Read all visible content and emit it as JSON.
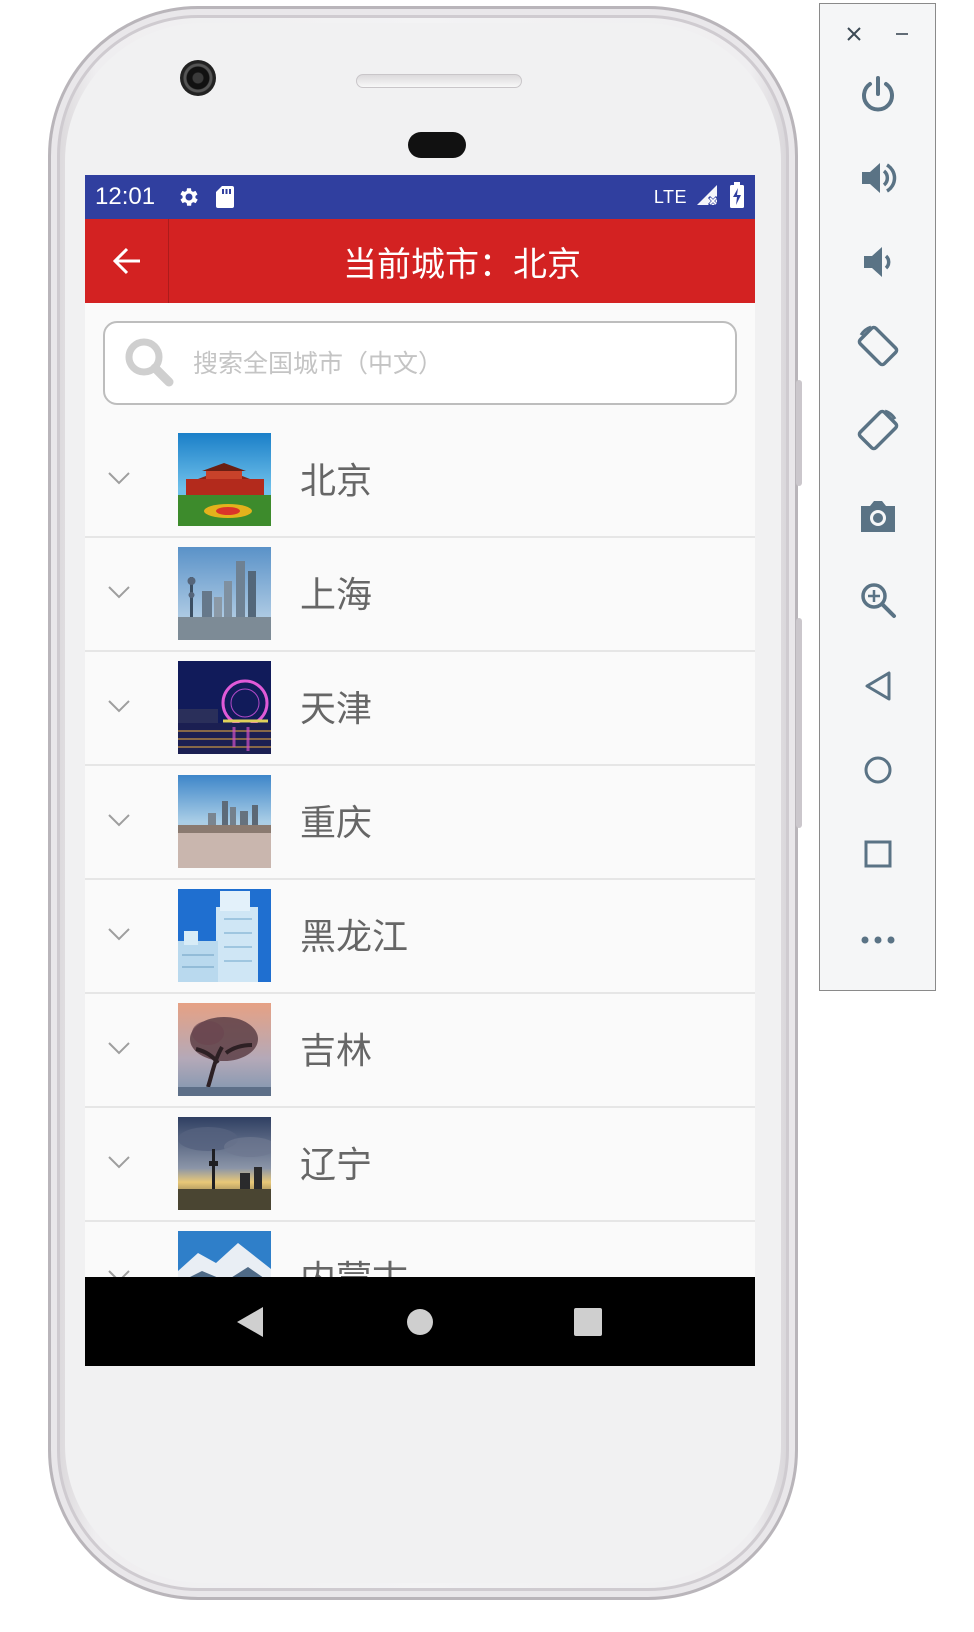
{
  "status_bar": {
    "time": "12:01",
    "network": "LTE",
    "icons": [
      "settings-icon",
      "sd-card-icon",
      "signal-icon",
      "battery-charging-icon"
    ],
    "color": "#303f9f"
  },
  "app_bar": {
    "title": "当前城市：北京",
    "back_icon": "arrow-left-icon",
    "color": "#d32222"
  },
  "search": {
    "placeholder": "搜索全国城市（中文）",
    "value": ""
  },
  "cities": [
    {
      "name": "北京",
      "image": "beijing-tiananmen-photo"
    },
    {
      "name": "上海",
      "image": "shanghai-skyline-photo"
    },
    {
      "name": "天津",
      "image": "tianjin-ferris-wheel-photo"
    },
    {
      "name": "重庆",
      "image": "chongqing-skyline-photo"
    },
    {
      "name": "黑龙江",
      "image": "heilongjiang-ice-sculpture-photo"
    },
    {
      "name": "吉林",
      "image": "jilin-tree-photo"
    },
    {
      "name": "辽宁",
      "image": "liaoning-tower-photo"
    },
    {
      "name": "内蒙古",
      "image": "inner-mongolia-mountains-photo"
    }
  ],
  "nav_bar": {
    "buttons": [
      "back-triangle-icon",
      "home-circle-icon",
      "recents-square-icon"
    ]
  },
  "emulator_toolbar": {
    "buttons": [
      "power-icon",
      "volume-up-icon",
      "volume-down-icon",
      "rotate-left-icon",
      "rotate-right-icon",
      "camera-icon",
      "zoom-icon",
      "back-icon",
      "home-icon",
      "overview-icon",
      "more-icon"
    ],
    "window_controls": [
      "close-icon",
      "minimize-icon"
    ]
  }
}
